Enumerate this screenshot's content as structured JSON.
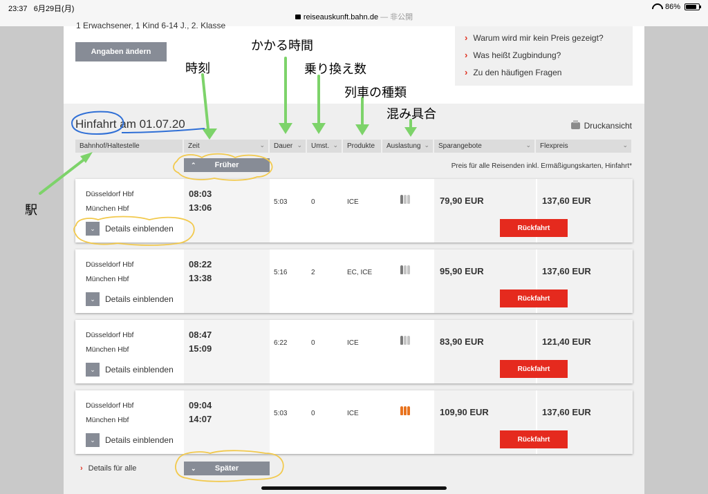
{
  "status_bar": {
    "time": "23:37",
    "date": "6月29日(月)",
    "url": "reiseauskunft.bahn.de",
    "url_suffix": "— 非公開",
    "battery": "86%",
    "battery_level": 0.86
  },
  "top": {
    "passengers": "1 Erwachsener, 1 Kind 6-14 J., 2. Klasse",
    "change_button": "Angaben ändern",
    "faq": [
      "Warum wird mir kein Preis gezeigt?",
      "Was heißt Zugbindung?",
      "Zu den häufigen Fragen"
    ]
  },
  "section": {
    "title": "Hinfahrt am 01.07.20",
    "print": "Druckansicht"
  },
  "columns": [
    "Bahnhof/Haltestelle",
    "Zeit",
    "Dauer",
    "Umst.",
    "Produkte",
    "Auslastung",
    "Sparangebote",
    "Flexpreis"
  ],
  "earlier_button": "Früher",
  "later_button": "Später",
  "price_note": "Preis für alle Reisenden inkl. Ermäßigungskarten, Hinfahrt*",
  "rows": [
    {
      "from": "Düsseldorf Hbf",
      "to": "München Hbf",
      "dep": "08:03",
      "arr": "13:06",
      "duration": "5:03",
      "changes": "0",
      "products": "ICE",
      "occupancy": "low",
      "saver": "79,90 EUR",
      "flex": "137,60 EUR",
      "details": "Details einblenden",
      "return": "Rückfahrt"
    },
    {
      "from": "Düsseldorf Hbf",
      "to": "München Hbf",
      "dep": "08:22",
      "arr": "13:38",
      "duration": "5:16",
      "changes": "2",
      "products": "EC, ICE",
      "occupancy": "low",
      "saver": "95,90 EUR",
      "flex": "137,60 EUR",
      "details": "Details einblenden",
      "return": "Rückfahrt"
    },
    {
      "from": "Düsseldorf Hbf",
      "to": "München Hbf",
      "dep": "08:47",
      "arr": "15:09",
      "duration": "6:22",
      "changes": "0",
      "products": "ICE",
      "occupancy": "low",
      "saver": "83,90 EUR",
      "flex": "121,40 EUR",
      "details": "Details einblenden",
      "return": "Rückfahrt"
    },
    {
      "from": "Düsseldorf Hbf",
      "to": "München Hbf",
      "dep": "09:04",
      "arr": "14:07",
      "duration": "5:03",
      "changes": "0",
      "products": "ICE",
      "occupancy": "high",
      "saver": "109,90 EUR",
      "flex": "137,60 EUR",
      "details": "Details einblenden",
      "return": "Rückfahrt"
    }
  ],
  "details_all": "Details für alle",
  "annotations": {
    "station": "駅",
    "time": "時刻",
    "duration": "かかる時間",
    "changes": "乗り換え数",
    "train_type": "列車の種類",
    "crowding": "混み具合"
  },
  "colors": {
    "accent_red": "#e52a1e",
    "button_grey": "#878c96",
    "occupancy_low": "#7a7a7a",
    "occupancy_high": "#e8731f",
    "annotation_green": "#7dd36a",
    "annotation_yellow": "#f2c94c",
    "annotation_blue": "#2f6fd6"
  }
}
